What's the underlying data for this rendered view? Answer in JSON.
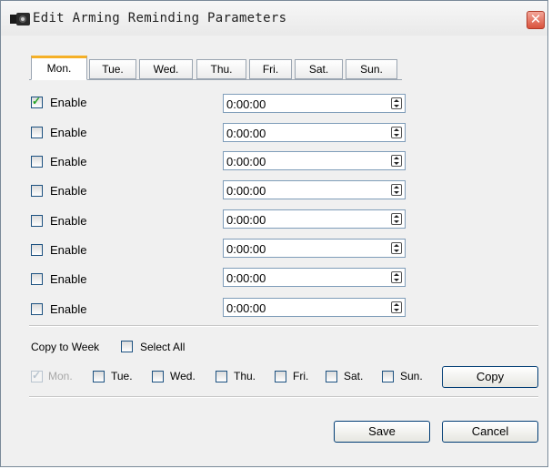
{
  "window": {
    "title": "Edit Arming Reminding Parameters",
    "close_glyph": "✕"
  },
  "tabs": [
    {
      "label": "Mon.",
      "active": true
    },
    {
      "label": "Tue.",
      "active": false
    },
    {
      "label": "Wed.",
      "active": false
    },
    {
      "label": "Thu.",
      "active": false
    },
    {
      "label": "Fri.",
      "active": false
    },
    {
      "label": "Sat.",
      "active": false
    },
    {
      "label": "Sun.",
      "active": false
    }
  ],
  "rows": [
    {
      "enable_label": "Enable",
      "checked": true,
      "time": "0:00:00"
    },
    {
      "enable_label": "Enable",
      "checked": false,
      "time": "0:00:00"
    },
    {
      "enable_label": "Enable",
      "checked": false,
      "time": "0:00:00"
    },
    {
      "enable_label": "Enable",
      "checked": false,
      "time": "0:00:00"
    },
    {
      "enable_label": "Enable",
      "checked": false,
      "time": "0:00:00"
    },
    {
      "enable_label": "Enable",
      "checked": false,
      "time": "0:00:00"
    },
    {
      "enable_label": "Enable",
      "checked": false,
      "time": "0:00:00"
    },
    {
      "enable_label": "Enable",
      "checked": false,
      "time": "0:00:00"
    }
  ],
  "copy": {
    "label": "Copy to Week",
    "select_all_label": "Select All",
    "days": [
      {
        "label": "Mon.",
        "checked": true,
        "disabled": true
      },
      {
        "label": "Tue.",
        "checked": false,
        "disabled": false
      },
      {
        "label": "Wed.",
        "checked": false,
        "disabled": false
      },
      {
        "label": "Thu.",
        "checked": false,
        "disabled": false
      },
      {
        "label": "Fri.",
        "checked": false,
        "disabled": false
      },
      {
        "label": "Sat.",
        "checked": false,
        "disabled": false
      },
      {
        "label": "Sun.",
        "checked": false,
        "disabled": false
      }
    ],
    "copy_button": "Copy"
  },
  "footer": {
    "save_label": "Save",
    "cancel_label": "Cancel"
  },
  "colors": {
    "active_tab_accent": "#f5b027",
    "close_button": "#d9523c",
    "check_color": "#21a121"
  }
}
